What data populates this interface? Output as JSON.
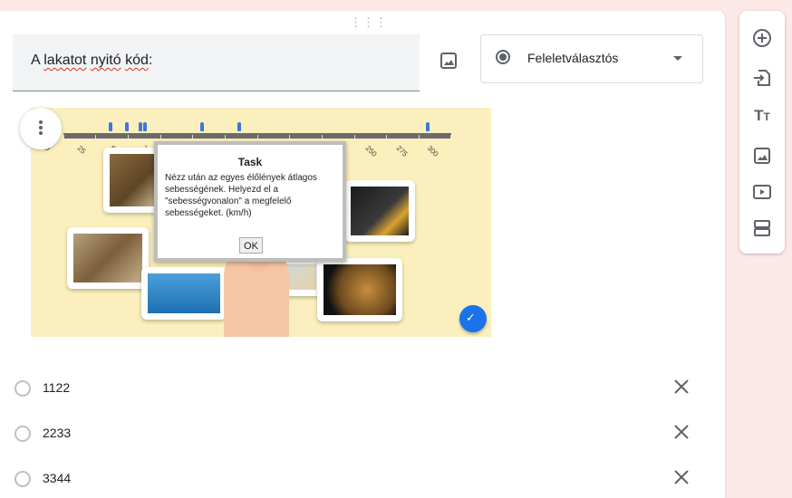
{
  "question": {
    "title_parts": [
      "A ",
      "lakatot",
      " ",
      "nyitó",
      " ",
      "kód",
      ":"
    ],
    "type_label": "Feleletválasztós"
  },
  "image": {
    "tick_labels": [
      "0",
      "25",
      "50",
      "75",
      "250",
      "275",
      "300"
    ],
    "dialog": {
      "title": "Task",
      "body": "Nézz után az egyes élőlények átlagos sebességének. Helyezd el a \"sebességvonalon\" a megfelelő sebességeket. (km/h)",
      "ok": "OK"
    }
  },
  "options": [
    {
      "label": "1122"
    },
    {
      "label": "2233"
    },
    {
      "label": "3344"
    }
  ],
  "toolbar": {
    "icons": [
      "add-question-icon",
      "import-questions-icon",
      "add-title-icon",
      "add-image-icon",
      "add-video-icon",
      "add-section-icon"
    ]
  },
  "colors": {
    "background": "#fce8e6",
    "accent": "#1a73e8",
    "image_background": "#fbf0bd"
  }
}
